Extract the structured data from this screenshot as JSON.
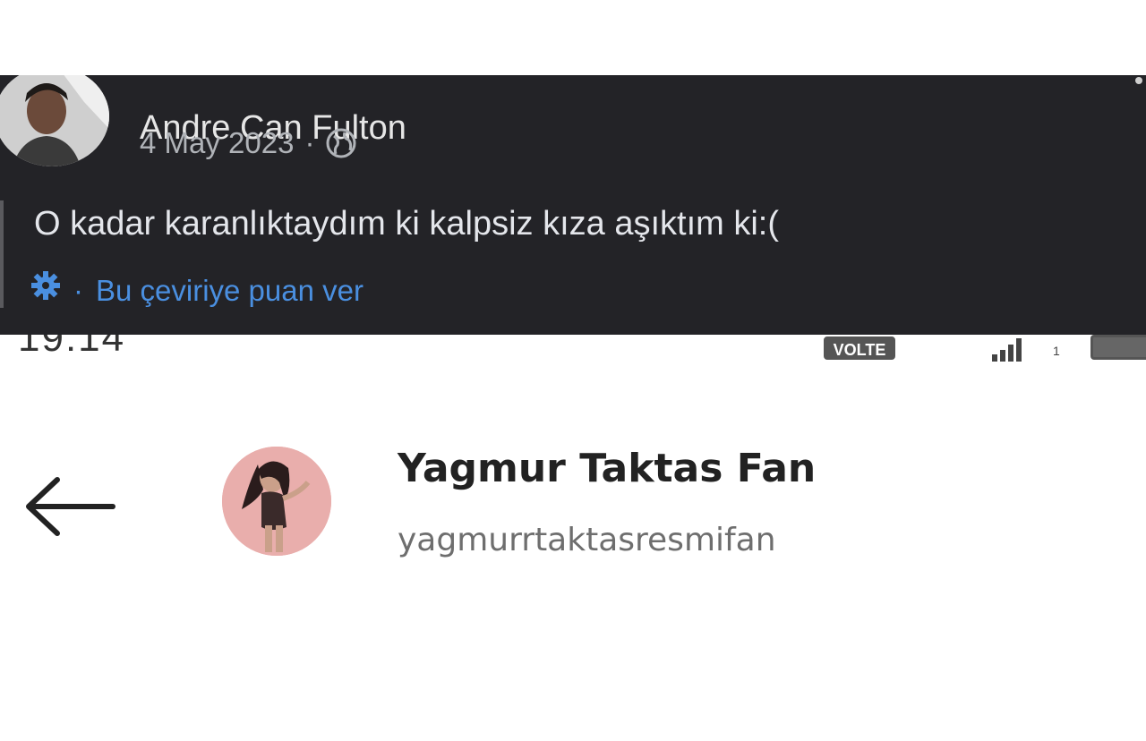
{
  "facebook_post": {
    "author_name": "Andre Can Fulton",
    "date": "4 May 2023",
    "separator": "·",
    "audience_icon": "globe-icon",
    "text": "O kadar karanlıktaydım ki kalpsiz kıza aşıktım ki:(",
    "translate_separator": "·",
    "translate_icon": "gear-icon",
    "translate_link": "Bu çeviriye puan ver",
    "colors": {
      "background": "#232327",
      "link": "#4a8fe0"
    }
  },
  "status_bar": {
    "time": "19:14",
    "network_badge": "VOLTE",
    "signal_sub": "1"
  },
  "profile_header": {
    "back_icon": "arrow-left-icon",
    "display_name": "Yagmur Taktas Fan",
    "username": "yagmurrtaktasresmifan"
  }
}
